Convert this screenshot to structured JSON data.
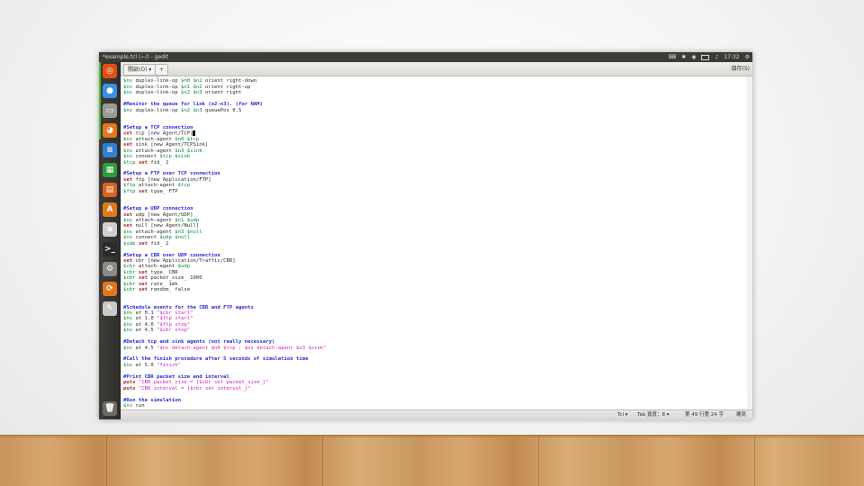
{
  "window": {
    "title": "*example.tcl (~/) - gedit",
    "tray": {
      "keyboard": "⌨",
      "bluetooth": "✱",
      "wifi": "◉",
      "battery": "",
      "volume": "♪",
      "clock": "17:32",
      "settings": "⚙"
    }
  },
  "toolbar": {
    "open_label": "開啟(O) ▾",
    "new_tab_label": "+",
    "save_label": "儲存(S)"
  },
  "launcher": {
    "items": [
      {
        "name": "ubuntu-dash-icon",
        "glyph": "◎",
        "color": "#e24d16"
      },
      {
        "name": "chromium-icon",
        "glyph": "●",
        "color": "#3c8fe8"
      },
      {
        "name": "files-icon",
        "glyph": "▭",
        "color": "#9a9a96"
      },
      {
        "name": "firefox-icon",
        "glyph": "◕",
        "color": "#e8761c"
      },
      {
        "name": "writer-icon",
        "glyph": "≡",
        "color": "#2f7fd4"
      },
      {
        "name": "calc-icon",
        "glyph": "▦",
        "color": "#2f9c3a"
      },
      {
        "name": "impress-icon",
        "glyph": "▤",
        "color": "#d8641c"
      },
      {
        "name": "software-center-icon",
        "glyph": "A",
        "color": "#e2781c"
      },
      {
        "name": "amazon-icon",
        "glyph": "a",
        "color": "#cfcfcf"
      },
      {
        "name": "terminal-icon",
        "glyph": ">_",
        "color": "#2b2b2b"
      },
      {
        "name": "system-settings-icon",
        "glyph": "⚙",
        "color": "#8a8a86"
      },
      {
        "name": "software-updater-icon",
        "glyph": "⟳",
        "color": "#e2781c"
      },
      {
        "name": "text-editor-icon",
        "glyph": "✎",
        "color": "#c9c9c5"
      },
      {
        "name": "trash-icon",
        "glyph": "🗑",
        "color": "#6a6a66"
      }
    ]
  },
  "editor": {
    "lines": [
      [
        {
          "t": "#Give node position (for NAM)",
          "c": "cm"
        }
      ],
      [
        {
          "t": "$ns",
          "c": "var"
        },
        {
          "t": " duplex-link-op "
        },
        {
          "t": "$n0 $n2",
          "c": "var"
        },
        {
          "t": " orient right-down"
        }
      ],
      [
        {
          "t": "$ns",
          "c": "var"
        },
        {
          "t": " duplex-link-op "
        },
        {
          "t": "$n1 $n2",
          "c": "var"
        },
        {
          "t": " orient right-up"
        }
      ],
      [
        {
          "t": "$ns",
          "c": "var"
        },
        {
          "t": " duplex-link-op "
        },
        {
          "t": "$n2 $n3",
          "c": "var"
        },
        {
          "t": " orient right"
        }
      ],
      [],
      [
        {
          "t": "#Monitor the queue for link (n2-n3). (for NAM)",
          "c": "cm"
        }
      ],
      [
        {
          "t": "$ns",
          "c": "var"
        },
        {
          "t": " duplex-link-op "
        },
        {
          "t": "$n2 $n3",
          "c": "var"
        },
        {
          "t": " queuePos 0.5"
        }
      ],
      [],
      [],
      [
        {
          "t": "#Setup a TCP connection",
          "c": "cm"
        }
      ],
      [
        {
          "t": "set",
          "c": "kw"
        },
        {
          "t": " tcp [new Agent/TCP]"
        },
        {
          "t": "",
          "c": "cursor"
        }
      ],
      [
        {
          "t": "$ns",
          "c": "var"
        },
        {
          "t": " attach-agent "
        },
        {
          "t": "$n0 $tcp",
          "c": "var"
        }
      ],
      [
        {
          "t": "set",
          "c": "kw"
        },
        {
          "t": " sink [new Agent/TCPSink]"
        }
      ],
      [
        {
          "t": "$ns",
          "c": "var"
        },
        {
          "t": " attach-agent "
        },
        {
          "t": "$n3 $sink",
          "c": "var"
        }
      ],
      [
        {
          "t": "$ns",
          "c": "var"
        },
        {
          "t": " connect "
        },
        {
          "t": "$tcp $sink",
          "c": "var"
        }
      ],
      [
        {
          "t": "$tcp",
          "c": "var"
        },
        {
          "t": " set",
          "c": "kw"
        },
        {
          "t": " fid_ 1"
        }
      ],
      [],
      [
        {
          "t": "#Setup a FTP over TCP connection",
          "c": "cm"
        }
      ],
      [
        {
          "t": "set",
          "c": "kw"
        },
        {
          "t": " ftp [new Application/FTP]"
        }
      ],
      [
        {
          "t": "$ftp",
          "c": "var"
        },
        {
          "t": " attach-agent "
        },
        {
          "t": "$tcp",
          "c": "var"
        }
      ],
      [
        {
          "t": "$ftp",
          "c": "var"
        },
        {
          "t": " set",
          "c": "kw"
        },
        {
          "t": " type_ FTP"
        }
      ],
      [],
      [],
      [
        {
          "t": "#Setup a UDP connection",
          "c": "cm"
        }
      ],
      [
        {
          "t": "set",
          "c": "kw"
        },
        {
          "t": " udp [new Agent/UDP]"
        }
      ],
      [
        {
          "t": "$ns",
          "c": "var"
        },
        {
          "t": " attach-agent "
        },
        {
          "t": "$n1 $udp",
          "c": "var"
        }
      ],
      [
        {
          "t": "set",
          "c": "kw"
        },
        {
          "t": " null [new Agent/Null]"
        }
      ],
      [
        {
          "t": "$ns",
          "c": "var"
        },
        {
          "t": " attach-agent "
        },
        {
          "t": "$n3 $null",
          "c": "var"
        }
      ],
      [
        {
          "t": "$ns",
          "c": "var"
        },
        {
          "t": " connect "
        },
        {
          "t": "$udp $null",
          "c": "var"
        }
      ],
      [
        {
          "t": "$udp",
          "c": "var"
        },
        {
          "t": " set",
          "c": "kw"
        },
        {
          "t": " fid_ 2"
        }
      ],
      [],
      [
        {
          "t": "#Setup a CBR over UDP connection",
          "c": "cm"
        }
      ],
      [
        {
          "t": "set",
          "c": "kw"
        },
        {
          "t": " cbr [new Application/Traffic/CBR]"
        }
      ],
      [
        {
          "t": "$cbr",
          "c": "var"
        },
        {
          "t": " attach-agent "
        },
        {
          "t": "$udp",
          "c": "var"
        }
      ],
      [
        {
          "t": "$cbr",
          "c": "var"
        },
        {
          "t": " set",
          "c": "kw"
        },
        {
          "t": " type_ CBR"
        }
      ],
      [
        {
          "t": "$cbr",
          "c": "var"
        },
        {
          "t": " set",
          "c": "kw"
        },
        {
          "t": " packet_size_ 1000"
        }
      ],
      [
        {
          "t": "$cbr",
          "c": "var"
        },
        {
          "t": " set",
          "c": "kw"
        },
        {
          "t": " rate_ 1mb"
        }
      ],
      [
        {
          "t": "$cbr",
          "c": "var"
        },
        {
          "t": " set",
          "c": "kw"
        },
        {
          "t": " random_ false"
        }
      ],
      [],
      [],
      [
        {
          "t": "#Schedule events for the CBR and FTP agents",
          "c": "cm"
        }
      ],
      [
        {
          "t": "$ns",
          "c": "var"
        },
        {
          "t": " at 0.1 "
        },
        {
          "t": "\"$cbr start\"",
          "c": "str"
        }
      ],
      [
        {
          "t": "$ns",
          "c": "var"
        },
        {
          "t": " at 1.0 "
        },
        {
          "t": "\"$ftp start\"",
          "c": "str"
        }
      ],
      [
        {
          "t": "$ns",
          "c": "var"
        },
        {
          "t": " at 4.0 "
        },
        {
          "t": "\"$ftp stop\"",
          "c": "str"
        }
      ],
      [
        {
          "t": "$ns",
          "c": "var"
        },
        {
          "t": " at 4.5 "
        },
        {
          "t": "\"$cbr stop\"",
          "c": "str"
        }
      ],
      [],
      [
        {
          "t": "#Detach tcp and sink agents (not really necessary)",
          "c": "cm"
        }
      ],
      [
        {
          "t": "$ns",
          "c": "var"
        },
        {
          "t": " at 4.5 "
        },
        {
          "t": "\"$ns detach-agent $n0 $tcp ; $ns detach-agent $n3 $sink\"",
          "c": "str"
        }
      ],
      [],
      [
        {
          "t": "#Call the finish procedure after 5 seconds of simulation time",
          "c": "cm"
        }
      ],
      [
        {
          "t": "$ns",
          "c": "var"
        },
        {
          "t": " at 5.0 "
        },
        {
          "t": "\"finish\"",
          "c": "str"
        }
      ],
      [],
      [
        {
          "t": "#Print CBR packet size and interval",
          "c": "cm"
        }
      ],
      [
        {
          "t": "puts",
          "c": "kw"
        },
        {
          "t": " "
        },
        {
          "t": "\"CBR packet size = [$cbr set packet_size_]\"",
          "c": "str"
        }
      ],
      [
        {
          "t": "puts",
          "c": "kw"
        },
        {
          "t": " "
        },
        {
          "t": "\"CBR interval = [$cbr set interval_]\"",
          "c": "str"
        }
      ],
      [],
      [
        {
          "t": "#Run the simulation",
          "c": "cm"
        }
      ],
      [
        {
          "t": "$ns",
          "c": "var"
        },
        {
          "t": " run"
        }
      ]
    ]
  },
  "statusbar": {
    "language": "Tcl ▾",
    "tab_width": "Tab 寬度：8 ▾",
    "cursor_pos": "第 49 行第 24 字",
    "mode": "覆寫"
  }
}
